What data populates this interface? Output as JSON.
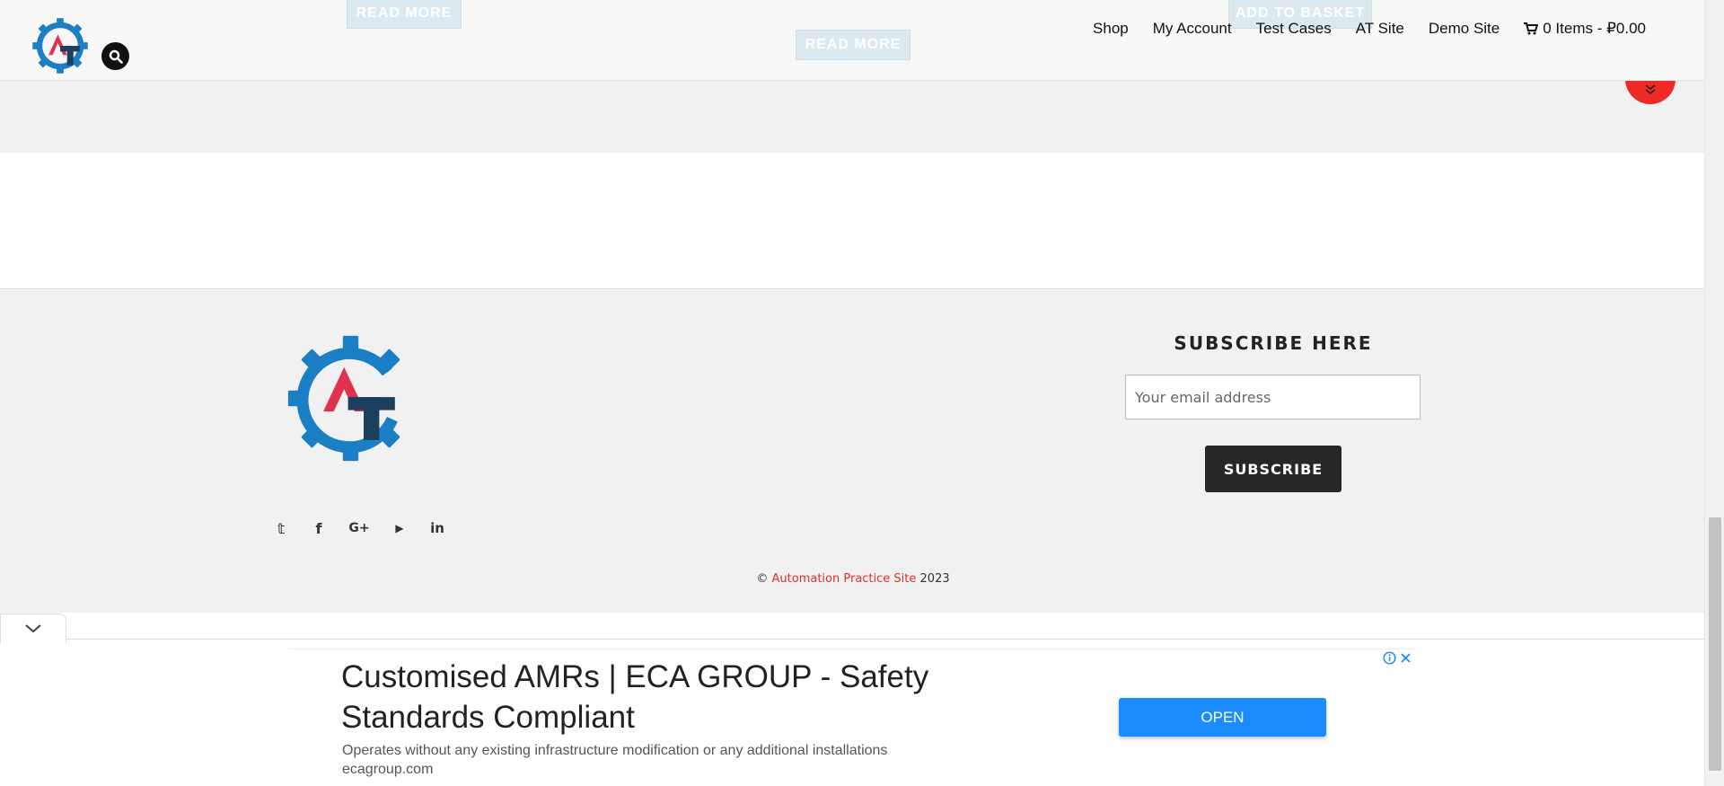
{
  "header": {
    "logo_alt": "AT",
    "ghost_buttons": [
      "READ MORE",
      "READ MORE",
      "ADD TO BASKET"
    ],
    "nav": [
      "Shop",
      "My Account",
      "Test Cases",
      "AT Site",
      "Demo Site"
    ],
    "cart_label": "0 Items - ₽0.00",
    "icons": {
      "search": "search-icon",
      "cart": "cart-icon",
      "scroll_down": "double-chevron-down-icon"
    }
  },
  "footer": {
    "social_icons": [
      "twitter-icon",
      "facebook-icon",
      "google-plus-icon",
      "youtube-icon",
      "linkedin-icon"
    ],
    "social_glyphs": [
      "𝕥",
      "f",
      "G+",
      "▶",
      "in"
    ],
    "subscribe_title": "SUBSCRIBE HERE",
    "email_placeholder": "Your email address",
    "subscribe_button": "SUBSCRIBE",
    "copyright_symbol": "©",
    "copyright_site": "Automation Practice Site",
    "copyright_year": "2023"
  },
  "ad": {
    "title": "Customised AMRs | ECA GROUP - Safety Standards Compliant",
    "description": "Operates without any existing infrastructure modification or any additional installations",
    "domain": "ecagroup.com",
    "open_button": "OPEN"
  },
  "colors": {
    "accent_red": "#d9322c",
    "logo_blue": "#1a7fc4",
    "logo_red": "#e0314f",
    "logo_dark": "#1d3f5e",
    "ad_button": "#1a8cff"
  }
}
